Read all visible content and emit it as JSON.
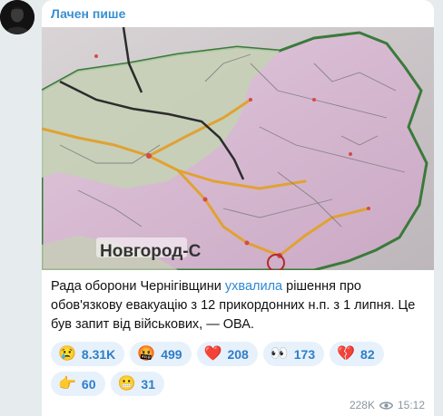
{
  "message": {
    "sender_name": "Лачен пише",
    "text_before_link": "Рада оборони Чернігівщини ",
    "link_text": "ухвалила",
    "text_after_link": " рішення про обов'язкову евакуацію з 12 прикордонних н.п. з 1 липня. Це був запит від військових, — ОВА.",
    "map_label": "Новгород-С",
    "views": "228K",
    "time": "15:12"
  },
  "reactions": [
    {
      "icon": "crying-face-icon",
      "emoji": "😢",
      "count": "8.31K"
    },
    {
      "icon": "angry-face-icon",
      "emoji": "🤬",
      "count": "499"
    },
    {
      "icon": "red-heart-icon",
      "emoji": "❤️",
      "count": "208"
    },
    {
      "icon": "eyes-icon",
      "emoji": "👀",
      "count": "173"
    },
    {
      "icon": "broken-heart-icon",
      "emoji": "💔",
      "count": "82"
    },
    {
      "icon": "pointing-hand-icon",
      "emoji": "👉",
      "count": "60"
    },
    {
      "icon": "grimacing-face-icon",
      "emoji": "😬",
      "count": "31"
    }
  ],
  "colors": {
    "sender": "#3a8fd0",
    "link": "#2d88d6",
    "reaction_bg": "#e7f1fb",
    "reaction_text": "#2e7ec7",
    "meta": "#8a959e",
    "chat_bg": "#e6ebee"
  }
}
